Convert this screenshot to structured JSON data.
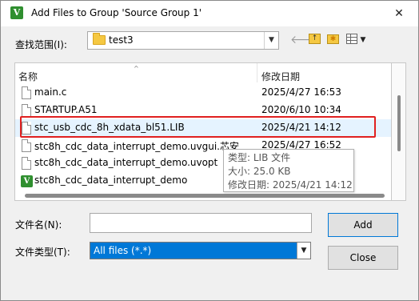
{
  "window": {
    "title": "Add Files to Group 'Source Group 1'",
    "close_glyph": "✕",
    "app_icon_letter": "V"
  },
  "look_in": {
    "label": "查找范围(I):",
    "value": "test3"
  },
  "toolbar": {
    "back_glyph": "🡐",
    "up_glyph": "↑",
    "new_folder_glyph": "✱",
    "view_menu_glyph": "▼",
    "combo_arrow_glyph": "▼"
  },
  "file_list": {
    "columns": [
      "名称",
      "修改日期"
    ],
    "sort_caret": "^",
    "rows": [
      {
        "name": "main.c",
        "date": "2025/4/27 16:53",
        "icon": "document-icon"
      },
      {
        "name": "STARTUP.A51",
        "date": "2020/6/10 10:34",
        "icon": "document-icon"
      },
      {
        "name": "stc_usb_cdc_8h_xdata_bl51.LIB",
        "date": "2025/4/21 14:12",
        "icon": "document-icon"
      },
      {
        "name": "stc8h_cdc_data_interrupt_demo.uvgui.芯安",
        "date": "2025/4/27 16:52",
        "icon": "document-icon"
      },
      {
        "name": "stc8h_cdc_data_interrupt_demo.uvopt",
        "date": "",
        "icon": "document-icon"
      },
      {
        "name": "stc8h_cdc_data_interrupt_demo",
        "date": "",
        "icon": "keil-project-icon"
      }
    ]
  },
  "tooltip": {
    "type": "类型: LIB 文件",
    "size": "大小: 25.0 KB",
    "modified": "修改日期: 2025/4/21 14:12"
  },
  "file_name": {
    "label": "文件名(N):",
    "value": ""
  },
  "file_type": {
    "label": "文件类型(T):",
    "value": "All files (*.*)"
  },
  "buttons": {
    "add": "Add",
    "close": "Close"
  },
  "colors": {
    "selection": "#0078d7",
    "highlight_border": "#e02020",
    "row_hover": "#e5f3ff"
  }
}
